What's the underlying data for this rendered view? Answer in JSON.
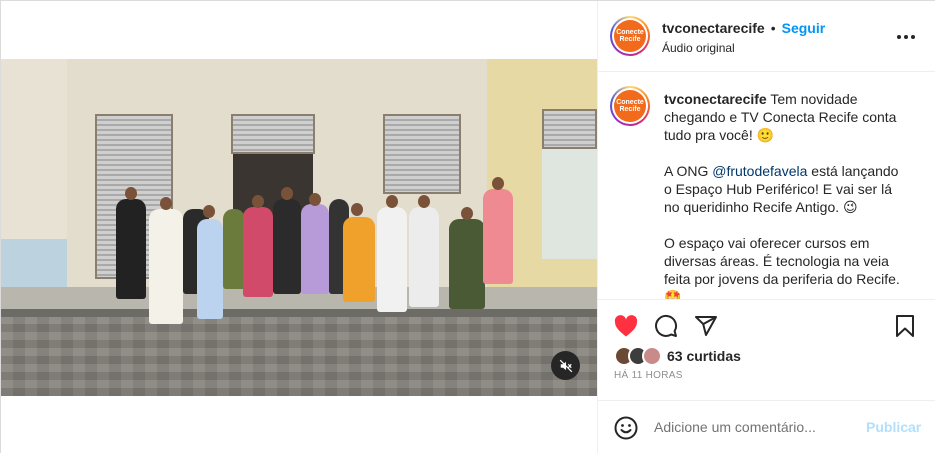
{
  "post": {
    "username": "tvconectarecife",
    "separator": "•",
    "follow_label": "Seguir",
    "audio_label": "Áudio original",
    "avatar_text": "Conecte Recife",
    "more_icon": "more-horizontal-icon",
    "mute_icon": "speaker-muted-icon"
  },
  "caption": {
    "username": "tvconectarecife",
    "intro": "Tem novidade chegando e TV Conecta Recife conta tudo pra você! 🙂",
    "para2_before": "A ONG ",
    "para2_mention": "@frutodefavela",
    "para2_after": " está lançando o Espaço Hub Periférico! E vai ser lá no queridinho Recife Antigo. 😉",
    "para3": "O espaço vai oferecer cursos em diversas áreas. É tecnologia na veia feita por jovens da periferia do Recife. 🤩"
  },
  "actions": {
    "like_icon": "heart-filled-icon",
    "comment_icon": "comment-icon",
    "share_icon": "paper-plane-icon",
    "save_icon": "bookmark-icon",
    "likes_text": "63 curtidas",
    "time_text": "HÁ 11 HORAS",
    "like_color": "#ff3040"
  },
  "comment": {
    "emoji_icon": "smiley-icon",
    "placeholder": "Adicione um comentário...",
    "publish_label": "Publicar"
  },
  "colors": {
    "brand_orange": "#f26a1b",
    "link_blue": "#0095f6",
    "publish_disabled": "#b2dffc"
  }
}
